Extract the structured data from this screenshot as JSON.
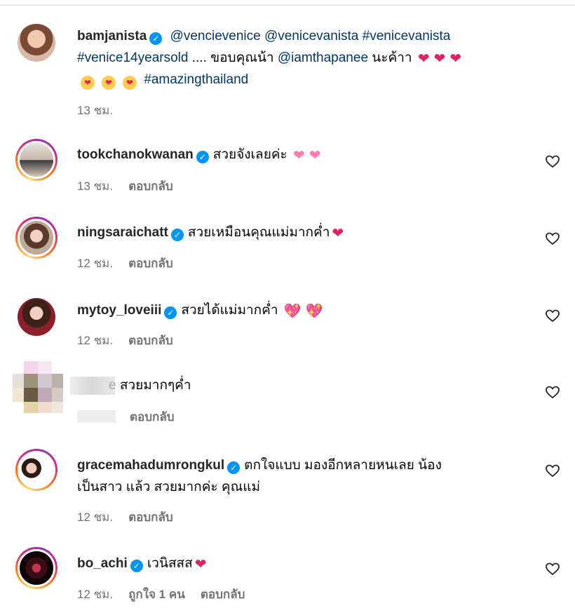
{
  "post": {
    "username": "bamjanista",
    "caption_tags_1": "@vencievenice @venicevanista #venicevanista",
    "caption_tag_2": "#venice14yearsold",
    "caption_text": " .... ขอบคุณน้า ",
    "caption_tag_3": "@iamthapanee",
    "caption_text_2": " นะค้าา",
    "caption_tag_4": "#amazingthailand",
    "time": "13 ชม."
  },
  "comments": [
    {
      "username": "tookchanokwanan",
      "text": "สวยจังเลยค่ะ",
      "time": "13 ชม.",
      "reply": "ตอบกลับ"
    },
    {
      "username": "ningsaraichatt",
      "text": "สวยเหมือนคุณแม่มากค่ำ",
      "time": "12 ชม.",
      "reply": "ตอบกลับ"
    },
    {
      "username": "mytoy_loveiii",
      "text": "สวยได้แม่มากค่ำ",
      "time": "12 ชม.",
      "reply": "ตอบกลับ"
    },
    {
      "username_partial": "e",
      "text": "สวยมากๆค่ำ",
      "reply": "ตอบกลับ"
    },
    {
      "username": "gracemahadumrongkul",
      "text": "ตกใจแบบ มองอีกหลายหนเลย น้อง",
      "text_line2": "เป็นสาว แล้ว สวยมากค่ะ คุณแม่",
      "time": "12 ชม.",
      "reply": "ตอบกลับ"
    },
    {
      "username": "bo_achi",
      "text": "เวนิสสส",
      "time": "12 ชม.",
      "likes": "ถูกใจ 1 คน",
      "reply": "ตอบกลับ"
    }
  ],
  "icons": {
    "verified": "verified-badge-icon",
    "like": "heart-outline-icon"
  },
  "colors": {
    "link": "#00376b",
    "verified": "#0095f6",
    "meta": "#737373"
  }
}
